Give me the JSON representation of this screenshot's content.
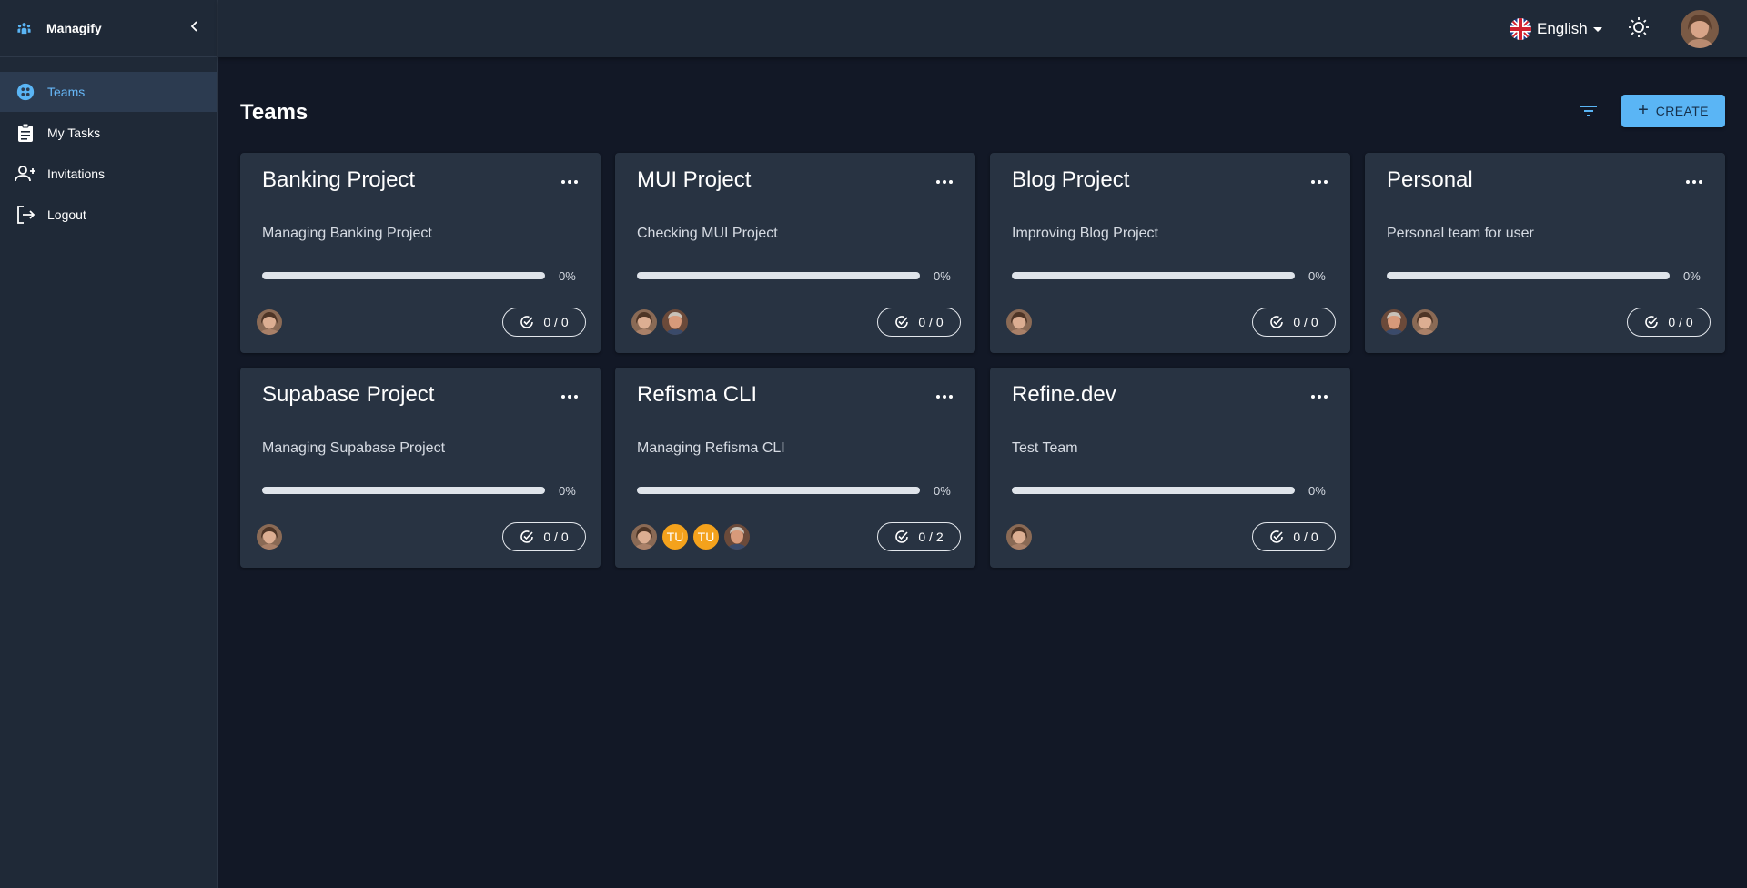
{
  "app": {
    "name": "Managify"
  },
  "sidebar": {
    "items": [
      {
        "label": "Teams",
        "icon": "teams-icon",
        "active": true
      },
      {
        "label": "My Tasks",
        "icon": "clipboard-icon",
        "active": false
      },
      {
        "label": "Invitations",
        "icon": "person-add-icon",
        "active": false
      },
      {
        "label": "Logout",
        "icon": "logout-icon",
        "active": false
      }
    ]
  },
  "header": {
    "language": "English",
    "language_flag": "uk-flag-icon"
  },
  "page": {
    "title": "Teams",
    "create_label": "CREATE",
    "create_plus": "+"
  },
  "colors": {
    "accent": "#5ab5f5",
    "avatar_initials_bg": "#f4a21c",
    "card_bg": "#283342"
  },
  "teams": [
    {
      "name": "Banking Project",
      "description": "Managing Banking Project",
      "progress": 0,
      "progress_label": "0%",
      "tasks": "0 / 0",
      "members": [
        {
          "type": "photo",
          "tone": "female"
        }
      ]
    },
    {
      "name": "MUI Project",
      "description": "Checking MUI Project",
      "progress": 0,
      "progress_label": "0%",
      "tasks": "0 / 0",
      "members": [
        {
          "type": "photo",
          "tone": "female"
        },
        {
          "type": "photo",
          "tone": "male"
        }
      ]
    },
    {
      "name": "Blog Project",
      "description": "Improving Blog Project",
      "progress": 0,
      "progress_label": "0%",
      "tasks": "0 / 0",
      "members": [
        {
          "type": "photo",
          "tone": "female"
        }
      ]
    },
    {
      "name": "Personal",
      "description": "Personal team for user",
      "progress": 0,
      "progress_label": "0%",
      "tasks": "0 / 0",
      "members": [
        {
          "type": "photo",
          "tone": "male"
        },
        {
          "type": "photo",
          "tone": "female"
        }
      ]
    },
    {
      "name": "Supabase Project",
      "description": "Managing Supabase Project",
      "progress": 0,
      "progress_label": "0%",
      "tasks": "0 / 0",
      "members": [
        {
          "type": "photo",
          "tone": "female"
        }
      ]
    },
    {
      "name": "Refisma CLI",
      "description": "Managing Refisma CLI",
      "progress": 0,
      "progress_label": "0%",
      "tasks": "0 / 2",
      "members": [
        {
          "type": "photo",
          "tone": "female"
        },
        {
          "type": "initials",
          "text": "TU"
        },
        {
          "type": "initials",
          "text": "TU"
        },
        {
          "type": "photo",
          "tone": "male"
        }
      ]
    },
    {
      "name": "Refine.dev",
      "description": "Test Team",
      "progress": 0,
      "progress_label": "0%",
      "tasks": "0 / 0",
      "members": [
        {
          "type": "photo",
          "tone": "female"
        }
      ]
    }
  ]
}
